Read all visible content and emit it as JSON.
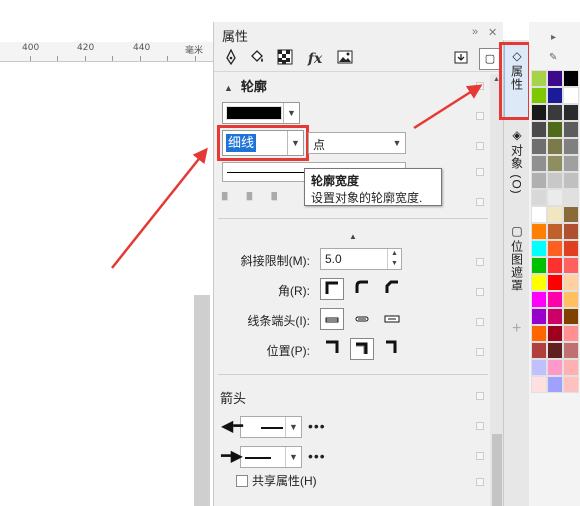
{
  "ruler": {
    "ticks": [
      "400",
      "420",
      "440",
      "毫米"
    ]
  },
  "panel": {
    "title": "属性",
    "controls": {
      "expand": "»",
      "close": "✕"
    },
    "tools": [
      "outline-pen-icon",
      "fill-bucket-icon",
      "checker-icon",
      "fx-icon",
      "image-icon"
    ],
    "tool_fx": "fx"
  },
  "outline": {
    "section_title": "轮廓",
    "color_hex": "#000000",
    "width_value": "细线",
    "unit_value": "点",
    "tooltip": {
      "title": "轮廓宽度",
      "body": "设置对象的轮廓宽度."
    },
    "miter_label": "斜接限制(M):",
    "miter_value": "5.0",
    "corner_label": "角(R):",
    "cap_label": "线条端头(I):",
    "position_label": "位置(P):"
  },
  "arrows": {
    "section_title": "箭头",
    "share_label": "共享属性(H)",
    "more": "•••"
  },
  "tabs": [
    {
      "name": "properties",
      "label": "属性",
      "icon": "◇"
    },
    {
      "name": "objects",
      "label": "对象 (O)",
      "icon": "◈"
    },
    {
      "name": "bitmap-mask",
      "label": "位图遮罩",
      "icon": "▢"
    }
  ],
  "plus": "+",
  "palette": {
    "arrow": "▸",
    "colors": [
      "#a7d34a",
      "#3c0a8a",
      "#000000",
      "#7dc800",
      "#1a1a9a",
      "#ffffff",
      "#1a1a1a",
      "#3a3a3a",
      "#2b2b2b",
      "#4b4b4b",
      "#4e6a1a",
      "#5d5d5d",
      "#6f6f6f",
      "#7b7b4a",
      "#808080",
      "#909090",
      "#8e8e60",
      "#a0a0a0",
      "#b0b0b0",
      "#c8c8c8",
      "#c0c0c0",
      "#d8d8d8",
      "#ebebeb",
      "#e0e0e0",
      "#ffffff",
      "#f2e6c0",
      "#8b6a3a",
      "#ff8000",
      "#c0602a",
      "#b05030",
      "#00ffff",
      "#ff6020",
      "#e04020",
      "#00c000",
      "#ff3030",
      "#ff6060",
      "#ffff00",
      "#ff0000",
      "#ffd0a0",
      "#ff00ff",
      "#ff00aa",
      "#ffc060",
      "#9900cc",
      "#cc0066",
      "#804000",
      "#ff6600",
      "#a00020",
      "#ff9090",
      "#b04040",
      "#602020",
      "#c07070",
      "#c0c0ff",
      "#ff99cc",
      "#ffb0b0",
      "#ffe0e0",
      "#a0a0ff",
      "#ffc0c0"
    ]
  }
}
